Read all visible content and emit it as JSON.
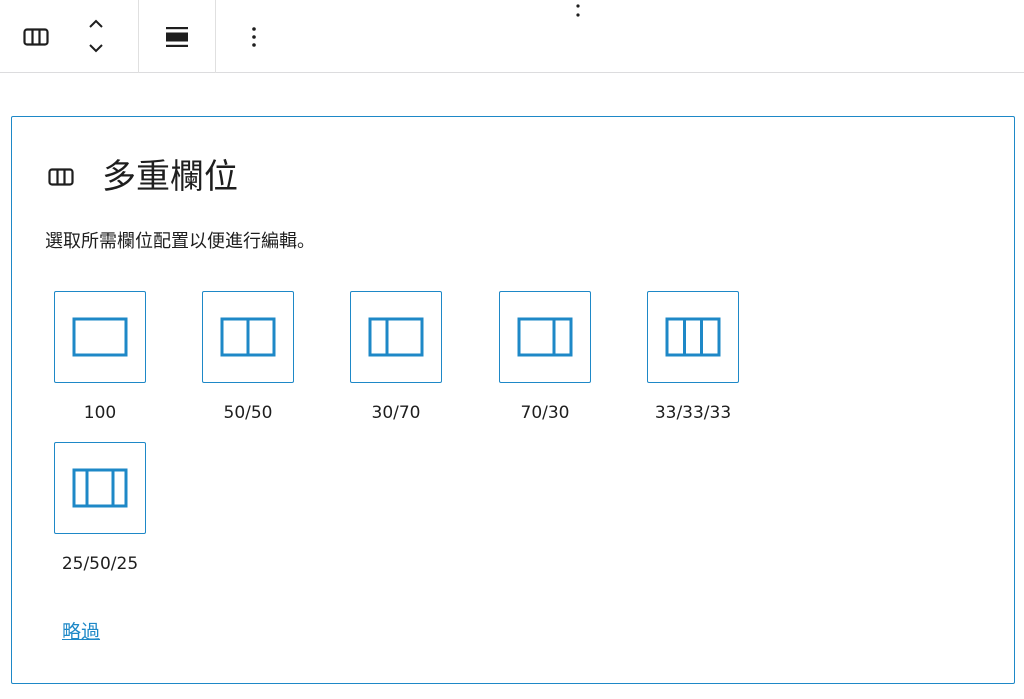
{
  "toolbar": {
    "block_type_icon": "columns-icon",
    "move_up_icon": "chevron-up-icon",
    "move_down_icon": "chevron-down-icon",
    "align_icon": "align-wide-icon",
    "options_icon": "more-vertical-icon"
  },
  "placeholder": {
    "icon": "columns-icon",
    "title": "多重欄位",
    "instructions": "選取所需欄位配置以便進行編輯。",
    "variations": [
      {
        "label": "100",
        "icon": "layout-100-icon"
      },
      {
        "label": "50/50",
        "icon": "layout-50-50-icon"
      },
      {
        "label": "30/70",
        "icon": "layout-30-70-icon"
      },
      {
        "label": "70/30",
        "icon": "layout-70-30-icon"
      },
      {
        "label": "33/33/33",
        "icon": "layout-33-33-33-icon"
      },
      {
        "label": "25/50/25",
        "icon": "layout-25-50-25-icon"
      }
    ],
    "skip_label": "略過"
  },
  "colors": {
    "accent": "#1e88c7",
    "text": "#1e1e1e",
    "border": "#dcdcde"
  }
}
